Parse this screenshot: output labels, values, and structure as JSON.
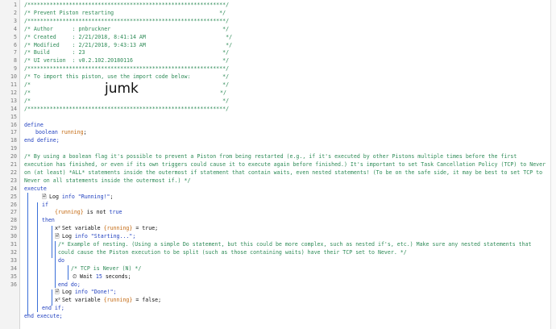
{
  "comments": {
    "border": "/**************************************************************/",
    "title": "/* Prevent Piston restarting                                 */",
    "author": "/* Author      : pnbruckner                                   */",
    "created": "/* Created     : 2/21/2018, 8:41:14 AM                         */",
    "modified": "/* Modified    : 2/21/2018, 9:43:13 AM                         */",
    "build": "/* Build       : 23                                           */",
    "ui_version": "/* UI version  : v0.2.102.20180116                            */",
    "import_line": "/* To import this piston, use the import code below:          */",
    "blank_a": "/*                                                            */",
    "import_pre": "/*                   ",
    "import_code": "jumk",
    "import_post": "                                        */",
    "blank_b": "/*                                                            */"
  },
  "define": {
    "keyword": "define",
    "var_type": "boolean",
    "var_name": "running",
    "end": "end define;"
  },
  "note": {
    "line1": "/* By using a boolean flag it's possible to prevent a Piston from being restarted (e.g., if it's executed by other Pistons multiple times before the first",
    "line2": "execution has finished, or even if its own triggers could cause it to execute again before finished.) It's important to set Task Cancellation Policy (TCP) to Never",
    "line3": "on (at least) *ALL* statements inside the outermost if statement that contain waits, even nested statements! (To be on the safe side, it may be best to set TCP to",
    "line4": "Never on all statements inside the outermost if.) */"
  },
  "execute": {
    "keyword": "execute",
    "log_running_fn": "Log",
    "log_running_lvl": "info",
    "log_running_msg": "\"Running!\"",
    "if_kw": "if",
    "cond_var": "{running}",
    "cond_op": "is not",
    "cond_val": "true",
    "then_kw": "then",
    "set1_label": "Set variable",
    "set1_var": "{running}",
    "set1_val": "= true;",
    "log_start_fn": "Log",
    "log_start_lvl": "info",
    "log_start_msg": "\"Starting...\";",
    "nest_c1": "/* Example of nesting. (Using a simple Do statement, but this could be more complex, such as nested if's, etc.) Make sure any nested statements that",
    "nest_c2": "could cause the Piston execution to be split (such as those containing waits) have their TCP set to Never. */",
    "do_kw": "do",
    "tcp_comment": "/* TCP is Never (N) */",
    "wait_label": "Wait",
    "wait_num": "15",
    "wait_unit": "seconds;",
    "end_do": "end do;",
    "log_done_fn": "Log",
    "log_done_lvl": "info",
    "log_done_msg": "\"Done!\";",
    "set2_label": "Set variable",
    "set2_var": "{running}",
    "set2_val": "= false;",
    "end_if": "end if;",
    "end_execute": "end execute;"
  },
  "line_numbers": [
    "1",
    "2",
    "3",
    "4",
    "5",
    "6",
    "7",
    "8",
    "9",
    "10",
    "11",
    "12",
    "13",
    "14",
    "15",
    "16",
    "17",
    "18",
    "19",
    "20",
    "21",
    "22",
    "23",
    "24",
    "25",
    "26",
    "27",
    "28",
    "29",
    "30",
    "31",
    "32",
    "33",
    "34",
    "35",
    "36"
  ]
}
